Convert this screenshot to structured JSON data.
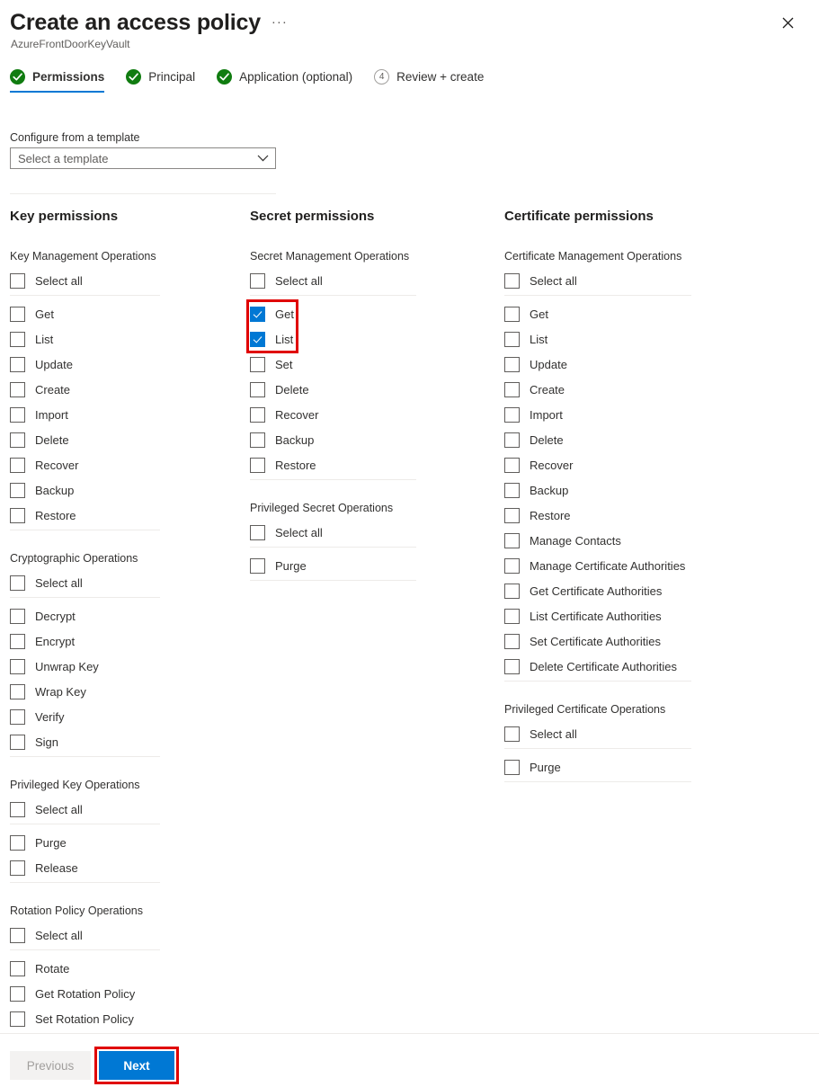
{
  "window": {
    "title": "Create an access policy",
    "subtitle": "AzureFrontDoorKeyVault",
    "more_label": "···",
    "close_label": "Close"
  },
  "wizard": {
    "tabs": [
      {
        "label": "Permissions",
        "state": "complete",
        "active": true
      },
      {
        "label": "Principal",
        "state": "complete",
        "active": false
      },
      {
        "label": "Application (optional)",
        "state": "complete",
        "active": false
      },
      {
        "label": "Review + create",
        "state": "pending",
        "number": "4",
        "active": false
      }
    ]
  },
  "template": {
    "label": "Configure from a template",
    "value": "Select a template",
    "placeholder": "Select a template"
  },
  "columns": [
    {
      "heading": "Key permissions",
      "groups": [
        {
          "title": "Key Management Operations",
          "select_all": {
            "label": "Select all",
            "checked": false
          },
          "items": [
            {
              "label": "Get",
              "checked": false
            },
            {
              "label": "List",
              "checked": false
            },
            {
              "label": "Update",
              "checked": false
            },
            {
              "label": "Create",
              "checked": false
            },
            {
              "label": "Import",
              "checked": false
            },
            {
              "label": "Delete",
              "checked": false
            },
            {
              "label": "Recover",
              "checked": false
            },
            {
              "label": "Backup",
              "checked": false
            },
            {
              "label": "Restore",
              "checked": false
            }
          ]
        },
        {
          "title": "Cryptographic Operations",
          "select_all": {
            "label": "Select all",
            "checked": false
          },
          "items": [
            {
              "label": "Decrypt",
              "checked": false
            },
            {
              "label": "Encrypt",
              "checked": false
            },
            {
              "label": "Unwrap Key",
              "checked": false
            },
            {
              "label": "Wrap Key",
              "checked": false
            },
            {
              "label": "Verify",
              "checked": false
            },
            {
              "label": "Sign",
              "checked": false
            }
          ]
        },
        {
          "title": "Privileged Key Operations",
          "select_all": {
            "label": "Select all",
            "checked": false
          },
          "items": [
            {
              "label": "Purge",
              "checked": false
            },
            {
              "label": "Release",
              "checked": false
            }
          ]
        },
        {
          "title": "Rotation Policy Operations",
          "select_all": {
            "label": "Select all",
            "checked": false
          },
          "items": [
            {
              "label": "Rotate",
              "checked": false
            },
            {
              "label": "Get Rotation Policy",
              "checked": false
            },
            {
              "label": "Set Rotation Policy",
              "checked": false
            }
          ]
        }
      ]
    },
    {
      "heading": "Secret permissions",
      "groups": [
        {
          "title": "Secret Management Operations",
          "select_all": {
            "label": "Select all",
            "checked": false
          },
          "items": [
            {
              "label": "Get",
              "checked": true
            },
            {
              "label": "List",
              "checked": true
            },
            {
              "label": "Set",
              "checked": false
            },
            {
              "label": "Delete",
              "checked": false
            },
            {
              "label": "Recover",
              "checked": false
            },
            {
              "label": "Backup",
              "checked": false
            },
            {
              "label": "Restore",
              "checked": false
            }
          ]
        },
        {
          "title": "Privileged Secret Operations",
          "select_all": {
            "label": "Select all",
            "checked": false
          },
          "items": [
            {
              "label": "Purge",
              "checked": false
            }
          ]
        }
      ]
    },
    {
      "heading": "Certificate permissions",
      "groups": [
        {
          "title": "Certificate Management Operations",
          "select_all": {
            "label": "Select all",
            "checked": false
          },
          "items": [
            {
              "label": "Get",
              "checked": false
            },
            {
              "label": "List",
              "checked": false
            },
            {
              "label": "Update",
              "checked": false
            },
            {
              "label": "Create",
              "checked": false
            },
            {
              "label": "Import",
              "checked": false
            },
            {
              "label": "Delete",
              "checked": false
            },
            {
              "label": "Recover",
              "checked": false
            },
            {
              "label": "Backup",
              "checked": false
            },
            {
              "label": "Restore",
              "checked": false
            },
            {
              "label": "Manage Contacts",
              "checked": false
            },
            {
              "label": "Manage Certificate Authorities",
              "checked": false
            },
            {
              "label": "Get Certificate Authorities",
              "checked": false
            },
            {
              "label": "List Certificate Authorities",
              "checked": false
            },
            {
              "label": "Set Certificate Authorities",
              "checked": false
            },
            {
              "label": "Delete Certificate Authorities",
              "checked": false
            }
          ]
        },
        {
          "title": "Privileged Certificate Operations",
          "select_all": {
            "label": "Select all",
            "checked": false
          },
          "items": [
            {
              "label": "Purge",
              "checked": false
            }
          ]
        }
      ]
    }
  ],
  "footer": {
    "previous_label": "Previous",
    "next_label": "Next"
  },
  "highlights": [
    {
      "name": "secret-get-list-highlight",
      "color": "#e00000"
    },
    {
      "name": "next-button-highlight",
      "color": "#e00000"
    }
  ],
  "colors": {
    "accent": "#0078d4",
    "success": "#107c10",
    "highlight": "#e00000",
    "text": "#323130",
    "muted": "#605e5c",
    "divider": "#edebe9"
  }
}
